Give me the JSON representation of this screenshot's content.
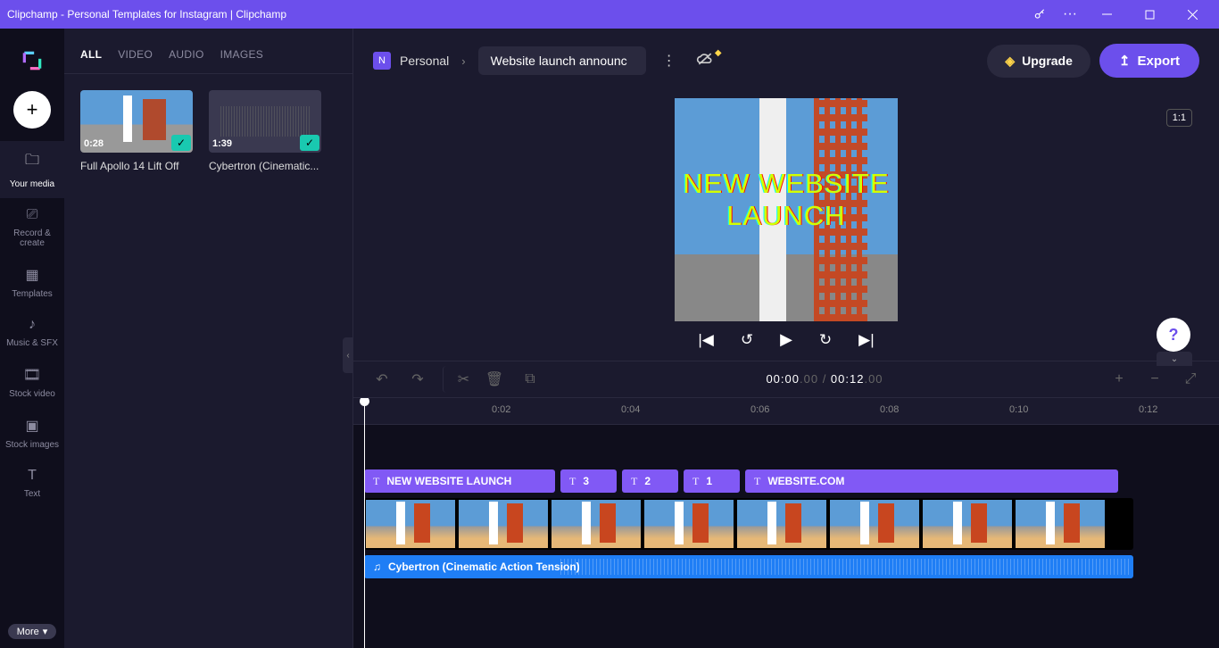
{
  "window": {
    "title": "Clipchamp - Personal Templates for Instagram | Clipchamp"
  },
  "rail": {
    "your_media": "Your media",
    "record": "Record &\ncreate",
    "templates": "Templates",
    "music": "Music & SFX",
    "stock_video": "Stock video",
    "stock_images": "Stock images",
    "text": "Text",
    "more": "More"
  },
  "tabs": {
    "all": "ALL",
    "video": "VIDEO",
    "audio": "AUDIO",
    "images": "IMAGES"
  },
  "media": {
    "item1": {
      "duration": "0:28",
      "name": "Full Apollo 14 Lift Off"
    },
    "item2": {
      "duration": "1:39",
      "name": "Cybertron (Cinematic..."
    }
  },
  "topbar": {
    "badge": "N",
    "workspace": "Personal",
    "project": "Website launch announc",
    "upgrade": "Upgrade",
    "export": "Export",
    "aspect": "1:1"
  },
  "preview": {
    "overlay_text": "NEW WEBSITE\nLAUNCH"
  },
  "timecode": {
    "current": "00:00",
    "cur_frac": ".00",
    "sep": " / ",
    "total": "00:12",
    "tot_frac": ".00"
  },
  "ruler": {
    "t0": "0:02",
    "t1": "0:04",
    "t2": "0:06",
    "t3": "0:08",
    "t4": "0:10",
    "t5": "0:12"
  },
  "clips": {
    "c1": "NEW WEBSITE LAUNCH",
    "c2": "3",
    "c3": "2",
    "c4": "1",
    "c5": "WEBSITE.COM",
    "audio": "Cybertron (Cinematic Action Tension)"
  }
}
